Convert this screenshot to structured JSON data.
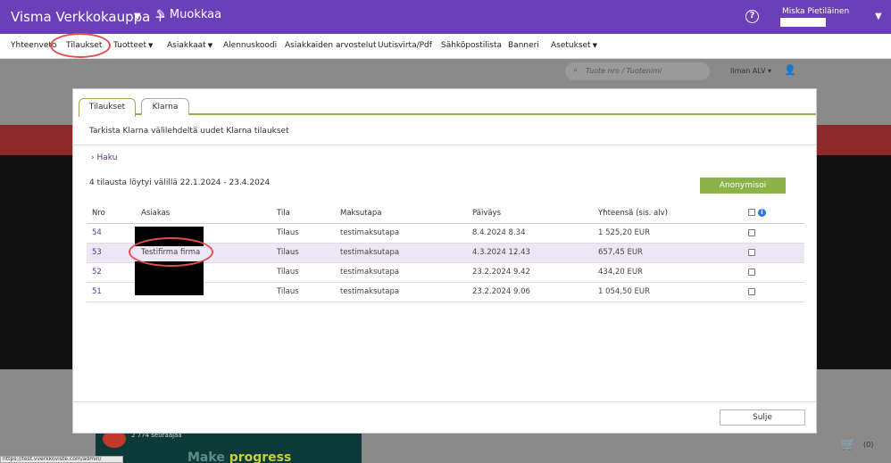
{
  "topbar": {
    "brand": "Visma Verkkokauppa +",
    "edit_label": "Muokkaa",
    "help": "?",
    "user_name": "Miska Pietiläinen"
  },
  "nav": {
    "items": [
      {
        "label": "Yhteenveto",
        "dropdown": false
      },
      {
        "label": "Tilaukset",
        "dropdown": false
      },
      {
        "label": "Tuotteet",
        "dropdown": true
      },
      {
        "label": "Asiakkaat",
        "dropdown": true
      },
      {
        "label": "Alennuskoodi",
        "dropdown": false
      },
      {
        "label": "Asiakkaiden arvostelut",
        "dropdown": false
      },
      {
        "label": "Uutisvirta/Pdf",
        "dropdown": false
      },
      {
        "label": "Sähköpostilista",
        "dropdown": false
      },
      {
        "label": "Banneri",
        "dropdown": false
      },
      {
        "label": "Asetukset",
        "dropdown": true
      }
    ]
  },
  "background": {
    "search_placeholder": "Tuote nro / Tuotenimi",
    "vat": "Ilman ALV",
    "banner_follow": "2 774 seuraajaa",
    "banner_make": "Make",
    "banner_progress": "progress",
    "cart_count": "(0)",
    "status_url": "https://test.vverkkoviste.com/admin/"
  },
  "modal": {
    "tabs": [
      {
        "label": "Tilaukset",
        "active": true
      },
      {
        "label": "Klarna",
        "active": false
      }
    ],
    "info": "Tarkista Klarna välilehdeltä uudet Klarna tilaukset",
    "haku": "Haku",
    "count_text": "4 tilausta löytyi välillä 22.1.2024 - 23.4.2024",
    "anon_button": "Anonymisoi",
    "columns": [
      "Nro",
      "Asiakas",
      "Tila",
      "Maksutapa",
      "Päiväys",
      "Yhteensä (sis. alv)"
    ],
    "rows": [
      {
        "nro": "54",
        "asiakas": "",
        "tila": "Tilaus",
        "maksutapa": "testimaksutapa",
        "paivays": "8.4.2024 8.34",
        "yhteensa": "1 525,20 EUR"
      },
      {
        "nro": "53",
        "asiakas": "Testifirma firma",
        "tila": "Tilaus",
        "maksutapa": "testimaksutapa",
        "paivays": "4.3.2024 12.43",
        "yhteensa": "657,45 EUR"
      },
      {
        "nro": "52",
        "asiakas": "",
        "tila": "Tilaus",
        "maksutapa": "testimaksutapa",
        "paivays": "23.2.2024 9.42",
        "yhteensa": "434,20 EUR"
      },
      {
        "nro": "51",
        "asiakas": "",
        "tila": "Tilaus",
        "maksutapa": "testimaksutapa",
        "paivays": "23.2.2024 9.06",
        "yhteensa": "1 054,50 EUR"
      }
    ],
    "close_button": "Sulje"
  },
  "colors": {
    "topbar": "#6b3fb8",
    "accent_green": "#8bb34a",
    "highlight_row": "#ece6f5",
    "annotation_red": "#e05050"
  }
}
